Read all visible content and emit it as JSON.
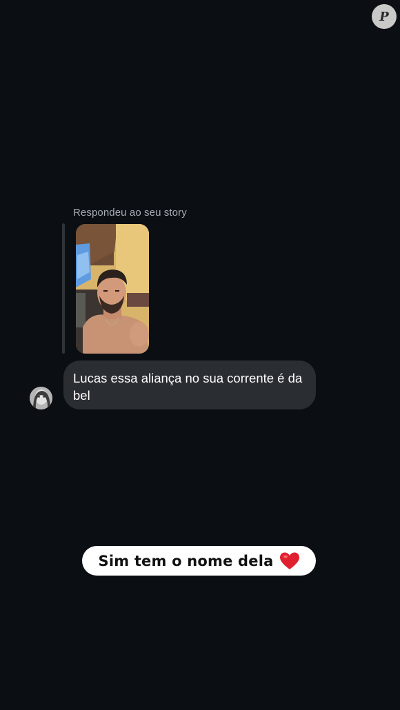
{
  "watermark": {
    "letter": "P",
    "icon": "purepeople-logo-icon"
  },
  "reply": {
    "caption": "Respondeu ao seu story",
    "thumbnail_icon": "story-photo-thumbnail"
  },
  "message": {
    "text": "Lucas essa aliança no sua corrente é da bel",
    "avatar_icon": "sender-avatar"
  },
  "overlay_caption": {
    "text": "Sim tem o nome dela",
    "emoji_icon": "red-heart-icon",
    "heart_color": "#e0202e"
  },
  "colors": {
    "background": "#0b0f14",
    "bubble": "#2a2d32",
    "caption_text": "#a7adb4"
  }
}
